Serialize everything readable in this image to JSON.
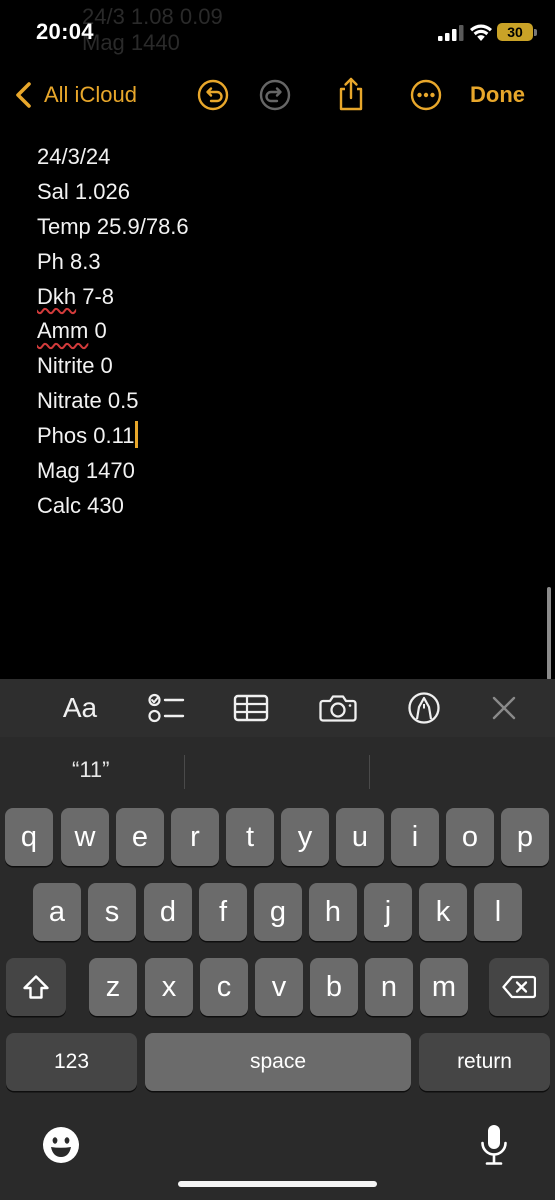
{
  "status_bar": {
    "time": "20:04",
    "battery": "30",
    "ghost_lines": [
      "24/3 1.08 0.09",
      "Mag 1440"
    ]
  },
  "nav": {
    "back_label": "All iCloud",
    "done_label": "Done",
    "accent_color": "#e8a72b"
  },
  "note": {
    "lines": [
      "24/3/24",
      "Sal 1.026",
      "Temp 25.9/78.6",
      "Ph 8.3",
      "Dkh",
      " 7-8",
      "Amm",
      " 0",
      "Nitrite 0",
      "Nitrate 0.5",
      "Phos 0.11",
      "Mag 1470",
      "Calc 430"
    ]
  },
  "format_toolbar": {
    "text_style_label": "Aa"
  },
  "keyboard": {
    "suggestion": "“11”",
    "row1": [
      "q",
      "w",
      "e",
      "r",
      "t",
      "y",
      "u",
      "i",
      "o",
      "p"
    ],
    "row2": [
      "a",
      "s",
      "d",
      "f",
      "g",
      "h",
      "j",
      "k",
      "l"
    ],
    "row3": [
      "z",
      "x",
      "c",
      "v",
      "b",
      "n",
      "m"
    ],
    "numbers_label": "123",
    "space_label": "space",
    "return_label": "return"
  }
}
